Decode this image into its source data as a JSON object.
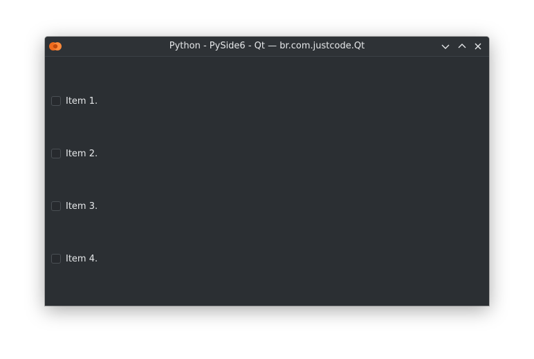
{
  "window": {
    "title": "Python - PySide6 - Qt — br.com.justcode.Qt",
    "app_icon": "qt-app-icon",
    "controls": {
      "minimize_icon": "chevron-down-icon",
      "maximize_icon": "chevron-up-icon",
      "close_icon": "close-icon"
    }
  },
  "checkboxes": [
    {
      "label": "Item 1.",
      "checked": false
    },
    {
      "label": "Item 2.",
      "checked": false
    },
    {
      "label": "Item 3.",
      "checked": false
    },
    {
      "label": "Item 4.",
      "checked": false
    }
  ],
  "colors": {
    "window_bg": "#2b2f33",
    "text": "#e6e8ea",
    "accent": "#f06b1d"
  }
}
